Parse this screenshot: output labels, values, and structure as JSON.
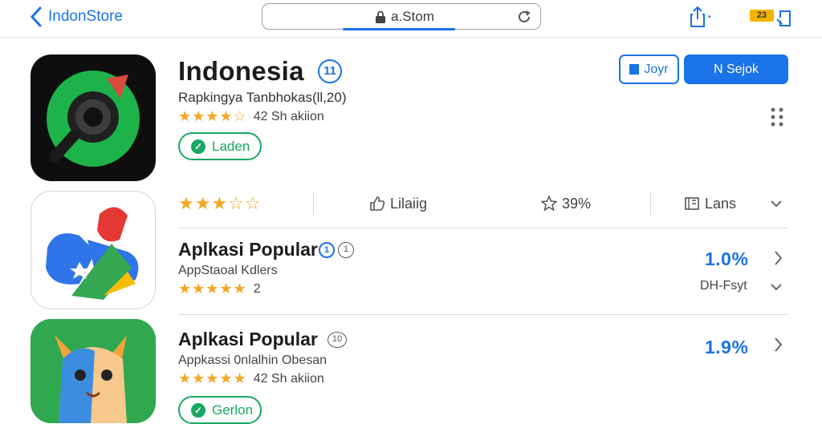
{
  "topbar": {
    "back_label": "IndonStore",
    "url": "a.Stom",
    "tabs_badge": "23"
  },
  "featured": {
    "title": "Indonesia",
    "info_badge": "11",
    "subtitle": "Rapkingya Tanbhokas(ll,20)",
    "stars": "★★★★☆",
    "rating_text": "42 Sh akiion",
    "pill_label": "Laden",
    "btn_outline_label": "Joyr",
    "btn_primary_label": "N Sejok"
  },
  "stats": {
    "stars": "★★★☆☆",
    "likes": "Lilaiig",
    "percent": "39%",
    "lang": "Lans"
  },
  "rows": [
    {
      "title": "Aplkasi Popular",
      "badge1": "1",
      "badge2": "1",
      "subtitle": "AppStaoal Kdlers",
      "stars": "★★★★★",
      "count": "2",
      "pct": "1.0%",
      "meta": "DH-Fsyt"
    },
    {
      "title": "Aplkasi Popular",
      "badge1": "10",
      "subtitle": "Appkassi 0nlalhin Obesan",
      "stars": "★★★★★",
      "count": "42 Sh akiion",
      "pct": "1.9%",
      "pill_label": "Gerlon"
    }
  ],
  "colors": {
    "accent": "#1a73e8",
    "green": "#17a861",
    "star": "#f5a623"
  }
}
